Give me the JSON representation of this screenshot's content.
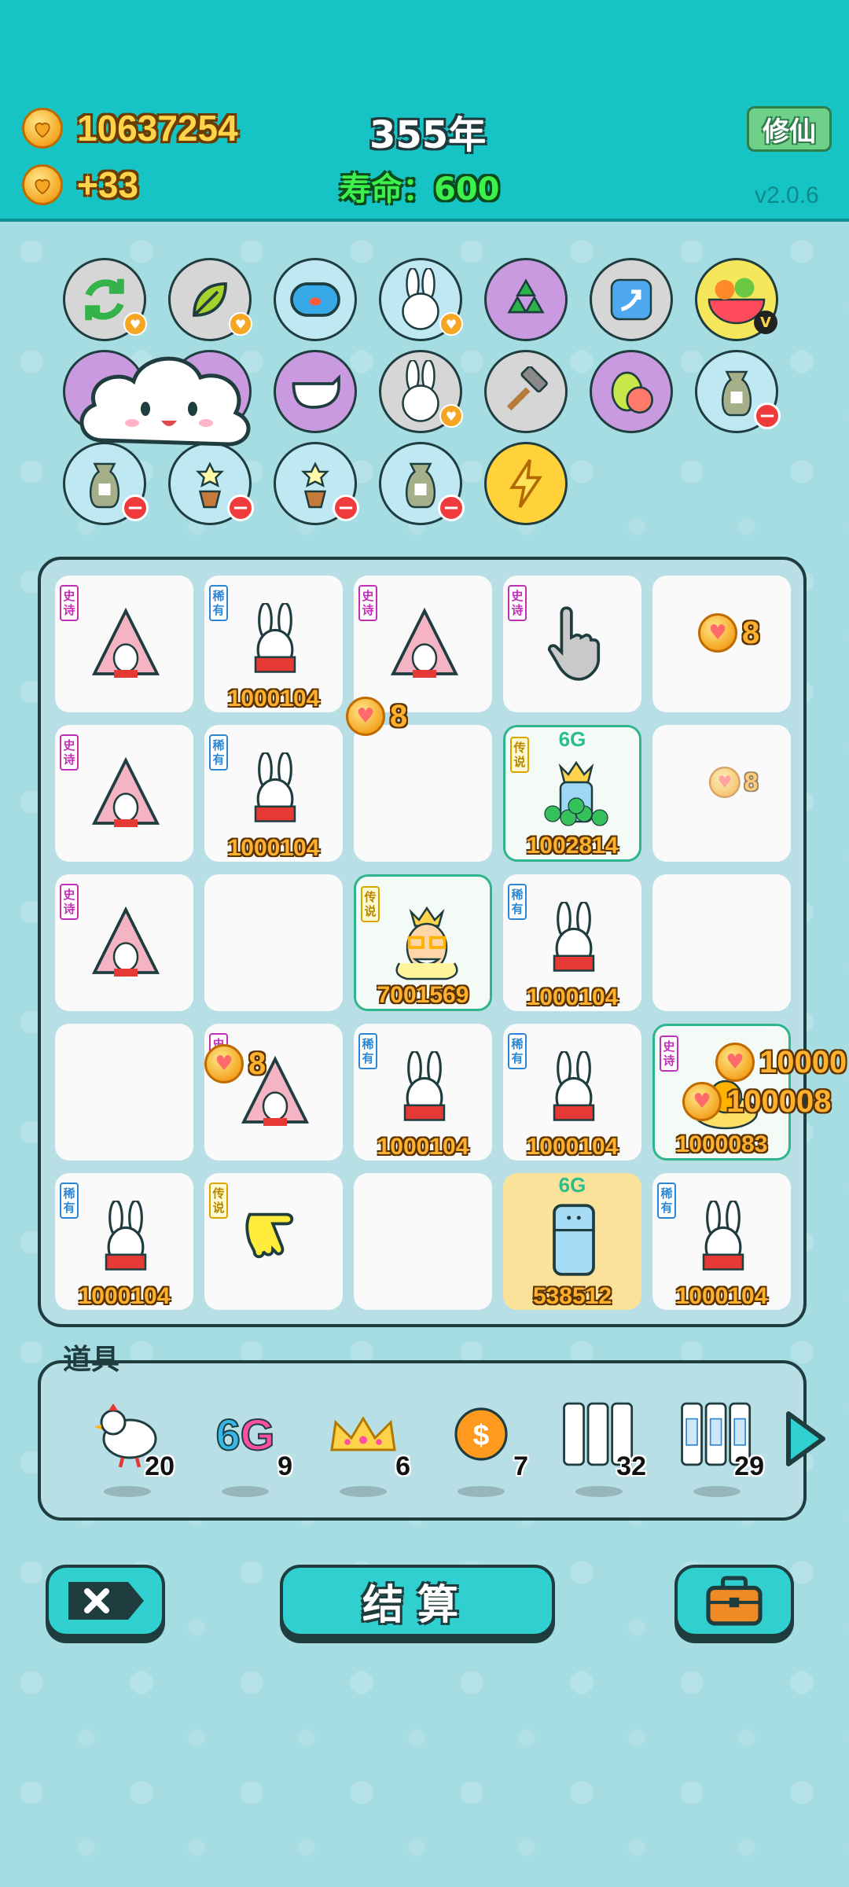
{
  "header": {
    "gold_total": "10637254",
    "gold_rate": "+33",
    "year": "355年",
    "life_label": "寿命：",
    "life_value": "600",
    "xiuxian_label": "修仙",
    "version": "v2.0.6"
  },
  "tags": {
    "epic": "史诗",
    "rare": "稀有",
    "legend": "传说"
  },
  "grid": {
    "r1c2_num": "1000104",
    "r2c2_num": "1000104",
    "r2c4_num": "1002814",
    "r2c4_badge": "6G",
    "r3c3_num": "7001569",
    "r3c4_num": "1000104",
    "r4c3_num": "1000104",
    "r4c4_num": "1000104",
    "r4c5_num": "1000083",
    "r5c1_num": "1000104",
    "r5c4_num": "538512",
    "r5c4_badge": "6G",
    "r5c5_num": "1000104",
    "float_coin_r1": "8",
    "float_coin_r2": "8",
    "float_coin_r2_small": "8",
    "float_coin_r4": "8",
    "float_coin_right1": "10000",
    "float_coin_right2": "100008"
  },
  "props": {
    "label": "道具",
    "items": [
      {
        "name": "chicken",
        "count": "20"
      },
      {
        "name": "6G",
        "count": "9"
      },
      {
        "name": "crown",
        "count": "6"
      },
      {
        "name": "coin",
        "count": "7"
      },
      {
        "name": "empty-slots",
        "count": "32"
      },
      {
        "name": "rare-slots",
        "count": "29"
      }
    ]
  },
  "buttons": {
    "settle": "结算"
  },
  "colors": {
    "header_bg": "#16c4c6",
    "page_bg": "#a6dde3",
    "button_bg": "#2fd0cf"
  }
}
